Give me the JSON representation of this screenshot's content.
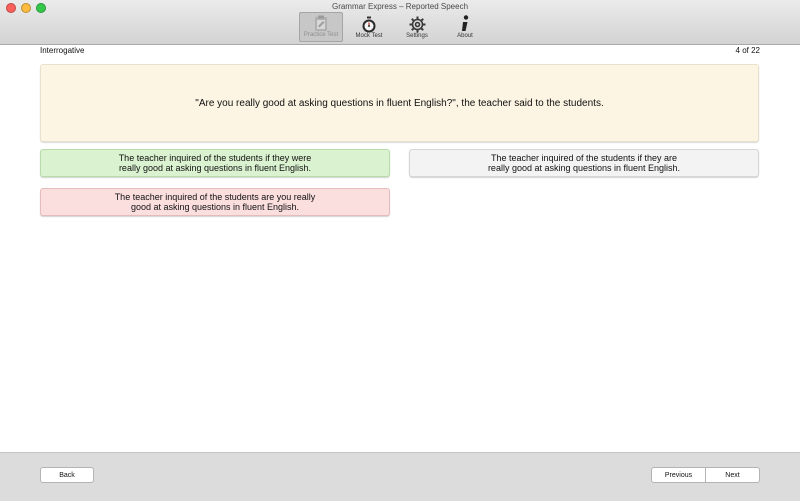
{
  "window": {
    "title": "Grammar Express – Reported Speech"
  },
  "toolbar": {
    "items": [
      {
        "label": "Practice Test",
        "icon": "clipboard-icon",
        "selected": true
      },
      {
        "label": "Mock Test",
        "icon": "stopwatch-icon",
        "selected": false
      },
      {
        "label": "Settings",
        "icon": "gear-icon",
        "selected": false
      },
      {
        "label": "About",
        "icon": "info-icon",
        "selected": false
      }
    ]
  },
  "header": {
    "category": "Interrogative",
    "progress": "4 of 22"
  },
  "question": {
    "text": "\"Are you really good at asking questions in fluent English?\", the teacher said to the students."
  },
  "options": [
    {
      "text": "The teacher inquired of the students if they were really good at asking questions in fluent English.",
      "state": "correct",
      "color": "#daf2d0"
    },
    {
      "text": "The teacher inquired of the students if they are really good at asking questions in fluent English.",
      "state": "neutral",
      "color": "#f3f3f3"
    },
    {
      "text": "The teacher inquired of the students are you really good at asking questions in fluent English.",
      "state": "wrong",
      "color": "#fbdede"
    }
  ],
  "navigation": {
    "back_label": "Back",
    "previous_label": "Previous",
    "next_label": "Next"
  },
  "colors": {
    "question_bg": "#fdf5e4",
    "correct": "#daf2d0",
    "wrong": "#fbdede",
    "neutral": "#f3f3f3"
  }
}
